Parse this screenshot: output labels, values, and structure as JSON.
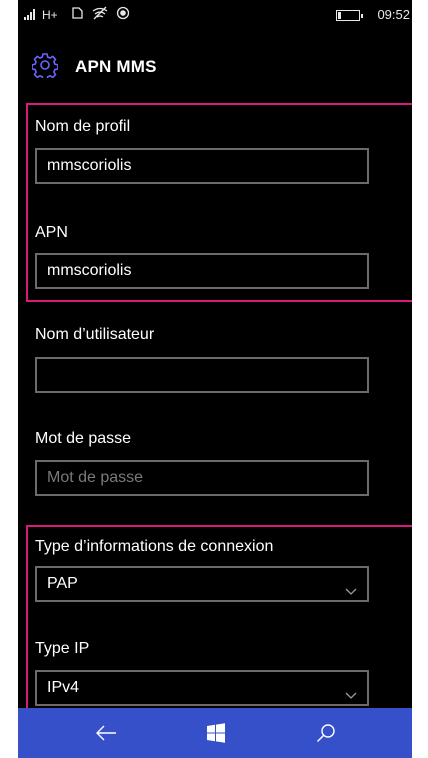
{
  "status_bar": {
    "network": "H+",
    "time": "09:52"
  },
  "header": {
    "title": "APN MMS",
    "icon": "gear-icon"
  },
  "form": {
    "profile_name": {
      "label": "Nom de profil",
      "value": "mmscoriolis"
    },
    "apn": {
      "label": "APN",
      "value": "mmscoriolis"
    },
    "username": {
      "label": "Nom d’utilisateur",
      "value": ""
    },
    "password": {
      "label": "Mot de passe",
      "placeholder": "Mot de passe"
    },
    "auth_type": {
      "label": "Type d’informations de connexion",
      "value": "PAP"
    },
    "ip_type": {
      "label": "Type IP",
      "value": "IPv4"
    }
  },
  "colors": {
    "highlight": "#d81b7a",
    "accent": "#6c62ff",
    "nav_bar": "#3550c8"
  },
  "nav_bar": {
    "icons": [
      "back-arrow-icon",
      "windows-logo-icon",
      "search-icon"
    ]
  }
}
